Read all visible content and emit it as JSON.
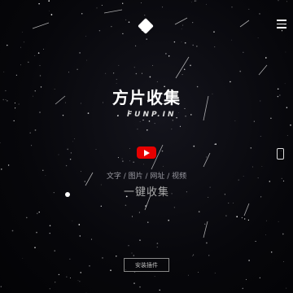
{
  "brand": {
    "title": "方片收集",
    "domain": ". FUNP.IN"
  },
  "header": {
    "logo_icon": "diamond-icon",
    "menu_icon": "menu-icon"
  },
  "main": {
    "video_icon": "youtube-play-icon",
    "mobile_icon": "mobile-phone-icon",
    "content_types": "文字 / 图片 / 网址 / 视频",
    "action_text": "一键收集"
  },
  "footer": {
    "install_label": "安装插件"
  },
  "colors": {
    "background": "#07070b",
    "accent": "#e60000",
    "text": "#ffffff"
  }
}
